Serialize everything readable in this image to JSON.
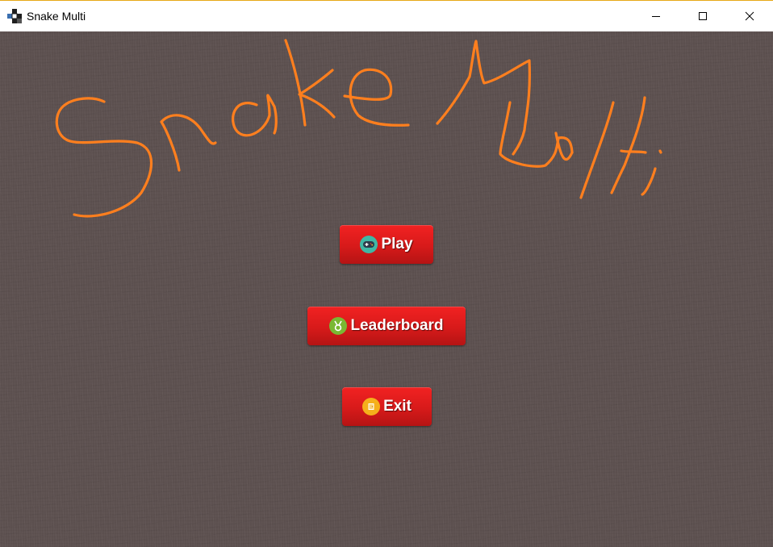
{
  "window": {
    "title": "Snake Multi"
  },
  "logo": {
    "text": "Snake Multi",
    "color": "#ff7f1e"
  },
  "menu": {
    "play": {
      "label": "Play",
      "icon": "gamepad-icon",
      "icon_color": "#3fb8a5"
    },
    "leaderboard": {
      "label": "Leaderboard",
      "icon": "medal-icon",
      "icon_color": "#7ab833"
    },
    "exit": {
      "label": "Exit",
      "icon": "exit-door-icon",
      "icon_color": "#f5b01b"
    }
  },
  "colors": {
    "background": "#5d5150",
    "button": "#e01f1f",
    "button_text": "#ffffff"
  }
}
